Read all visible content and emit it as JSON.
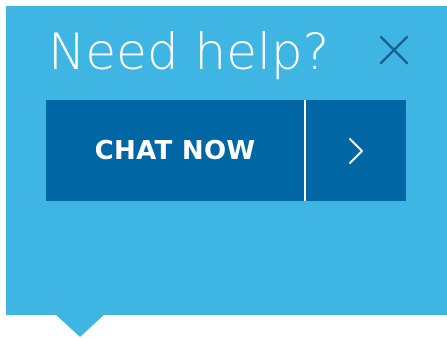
{
  "widget": {
    "title": "Need help?",
    "chat_label": "CHAT NOW",
    "icons": {
      "close": "close-icon",
      "arrow": "chevron-right-icon"
    },
    "colors": {
      "panel": "#3fb5e4",
      "button": "#0066a4",
      "close_icon": "#1a5f8f",
      "text": "#ffffff"
    }
  }
}
